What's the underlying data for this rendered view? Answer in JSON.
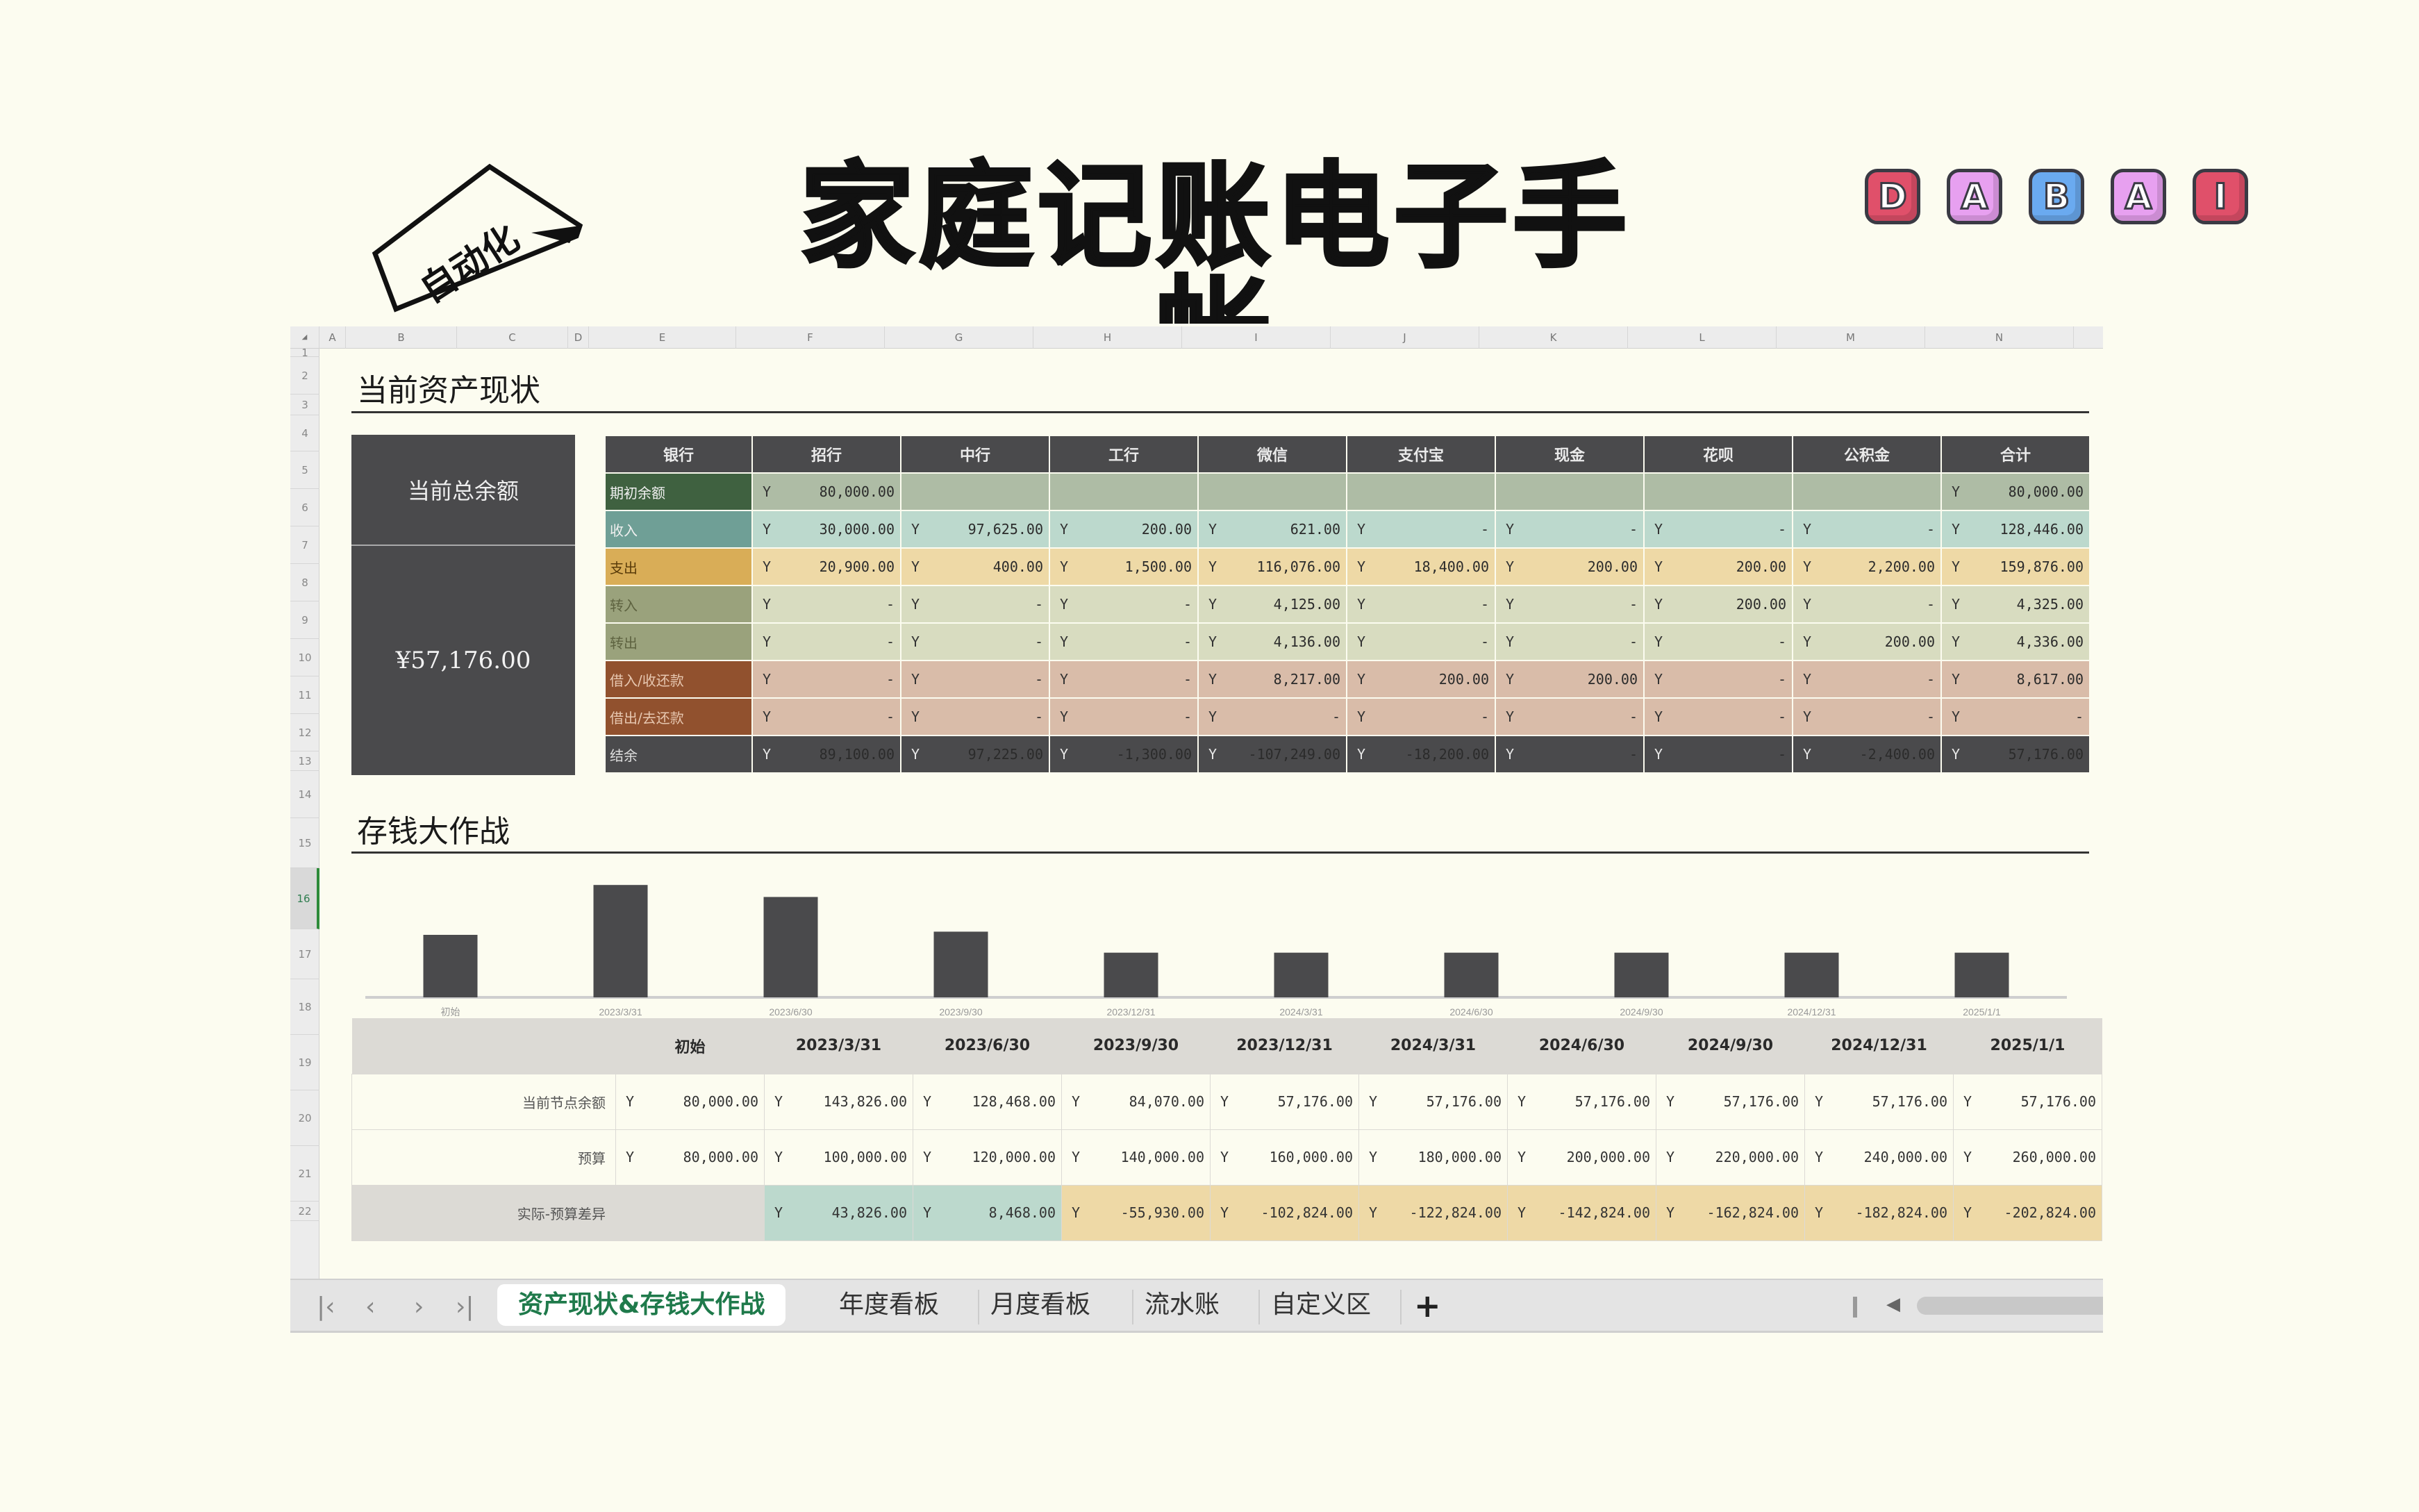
{
  "hero": {
    "title": "家庭记账电子手帐",
    "badge_text": "自动化",
    "brand_letters": [
      {
        "letter": "D",
        "color": "#e0506a"
      },
      {
        "letter": "A",
        "color": "#e7a0f0"
      },
      {
        "letter": "B",
        "color": "#6aaaf0"
      },
      {
        "letter": "A",
        "color": "#e7a0f0"
      },
      {
        "letter": "I",
        "color": "#e0506a"
      }
    ]
  },
  "sheet": {
    "columns": [
      "A",
      "B",
      "C",
      "D",
      "E",
      "F",
      "G",
      "H",
      "I",
      "J",
      "K",
      "L",
      "M",
      "N"
    ],
    "rows": [
      "1",
      "2",
      "3",
      "4",
      "5",
      "6",
      "7",
      "8",
      "9",
      "10",
      "11",
      "12",
      "13",
      "14",
      "15",
      "16",
      "17",
      "18",
      "19",
      "20",
      "21",
      "22"
    ],
    "active_row": "16"
  },
  "assets": {
    "section_title": "当前资产现状",
    "summary_label": "当前总余额",
    "summary_value": "¥57,176.00",
    "corner_header": "银行",
    "currency_symbol": "Y",
    "accounts": [
      "招行",
      "中行",
      "工行",
      "微信",
      "支付宝",
      "现金",
      "花呗",
      "公积金",
      "合计"
    ],
    "rows": [
      {
        "key": "opening",
        "label": "期初余额",
        "values": [
          "80,000.00",
          null,
          null,
          null,
          null,
          null,
          null,
          null,
          "80,000.00"
        ]
      },
      {
        "key": "income",
        "label": "收入",
        "values": [
          "30,000.00",
          "97,625.00",
          "200.00",
          "621.00",
          "-",
          "-",
          "-",
          "-",
          "128,446.00"
        ]
      },
      {
        "key": "expense",
        "label": "支出",
        "values": [
          "20,900.00",
          "400.00",
          "1,500.00",
          "116,076.00",
          "18,400.00",
          "200.00",
          "200.00",
          "2,200.00",
          "159,876.00"
        ]
      },
      {
        "key": "transin",
        "label": "转入",
        "values": [
          "-",
          "-",
          "-",
          "4,125.00",
          "-",
          "-",
          "200.00",
          "-",
          "4,325.00"
        ]
      },
      {
        "key": "transout",
        "label": "转出",
        "values": [
          "-",
          "-",
          "-",
          "4,136.00",
          "-",
          "-",
          "-",
          "200.00",
          "4,336.00"
        ]
      },
      {
        "key": "borrowin",
        "label": "借入/收还款",
        "values": [
          "-",
          "-",
          "-",
          "8,217.00",
          "200.00",
          "200.00",
          "-",
          "-",
          "8,617.00"
        ]
      },
      {
        "key": "lendout",
        "label": "借出/去还款",
        "values": [
          "-",
          "-",
          "-",
          "-",
          "-",
          "-",
          "-",
          "-",
          "-"
        ]
      },
      {
        "key": "balance",
        "label": "结余",
        "values": [
          "89,100.00",
          "97,225.00",
          "-1,300.00",
          "-107,249.00",
          "-18,200.00",
          "-",
          "-",
          "-2,400.00",
          "57,176.00"
        ]
      }
    ]
  },
  "savings": {
    "section_title": "存钱大作战",
    "periods": [
      "初始",
      "2023/3/31",
      "2023/6/30",
      "2023/9/30",
      "2023/12/31",
      "2024/3/31",
      "2024/6/30",
      "2024/9/30",
      "2024/12/31",
      "2025/1/1"
    ],
    "rows": [
      {
        "key": "balance",
        "label": "当前节点余额",
        "values": [
          "80,000.00",
          "143,826.00",
          "128,468.00",
          "84,070.00",
          "57,176.00",
          "57,176.00",
          "57,176.00",
          "57,176.00",
          "57,176.00",
          "57,176.00"
        ]
      },
      {
        "key": "budget",
        "label": "预算",
        "values": [
          "80,000.00",
          "100,000.00",
          "120,000.00",
          "140,000.00",
          "160,000.00",
          "180,000.00",
          "200,000.00",
          "220,000.00",
          "240,000.00",
          "260,000.00"
        ]
      },
      {
        "key": "diff",
        "label": "实际-预算差异",
        "values": [
          null,
          "43,826.00",
          "8,468.00",
          "-55,930.00",
          "-102,824.00",
          "-122,824.00",
          "-142,824.00",
          "-162,824.00",
          "-182,824.00",
          "-202,824.00"
        ]
      }
    ]
  },
  "chart_data": {
    "type": "bar",
    "title": "",
    "xlabel": "",
    "ylabel": "",
    "categories": [
      "初始",
      "2023/3/31",
      "2023/6/30",
      "2023/9/30",
      "2023/12/31",
      "2024/3/31",
      "2024/6/30",
      "2024/9/30",
      "2024/12/31",
      "2025/1/1"
    ],
    "values": [
      80000,
      143826,
      128468,
      84070,
      57176,
      57176,
      57176,
      57176,
      57176,
      57176
    ],
    "ylim": [
      0,
      160000
    ],
    "grid": false,
    "bar_color": "#4a4a4c"
  },
  "tabs": {
    "nav": [
      "first-sheet",
      "prev-sheet",
      "next-sheet",
      "last-sheet"
    ],
    "items": [
      {
        "label": "资产现状&存钱大作战",
        "active": true
      },
      {
        "label": "年度看板",
        "active": false
      },
      {
        "label": "月度看板",
        "active": false
      },
      {
        "label": "流水账",
        "active": false
      },
      {
        "label": "自定义区",
        "active": false
      }
    ],
    "add_label": "+"
  }
}
